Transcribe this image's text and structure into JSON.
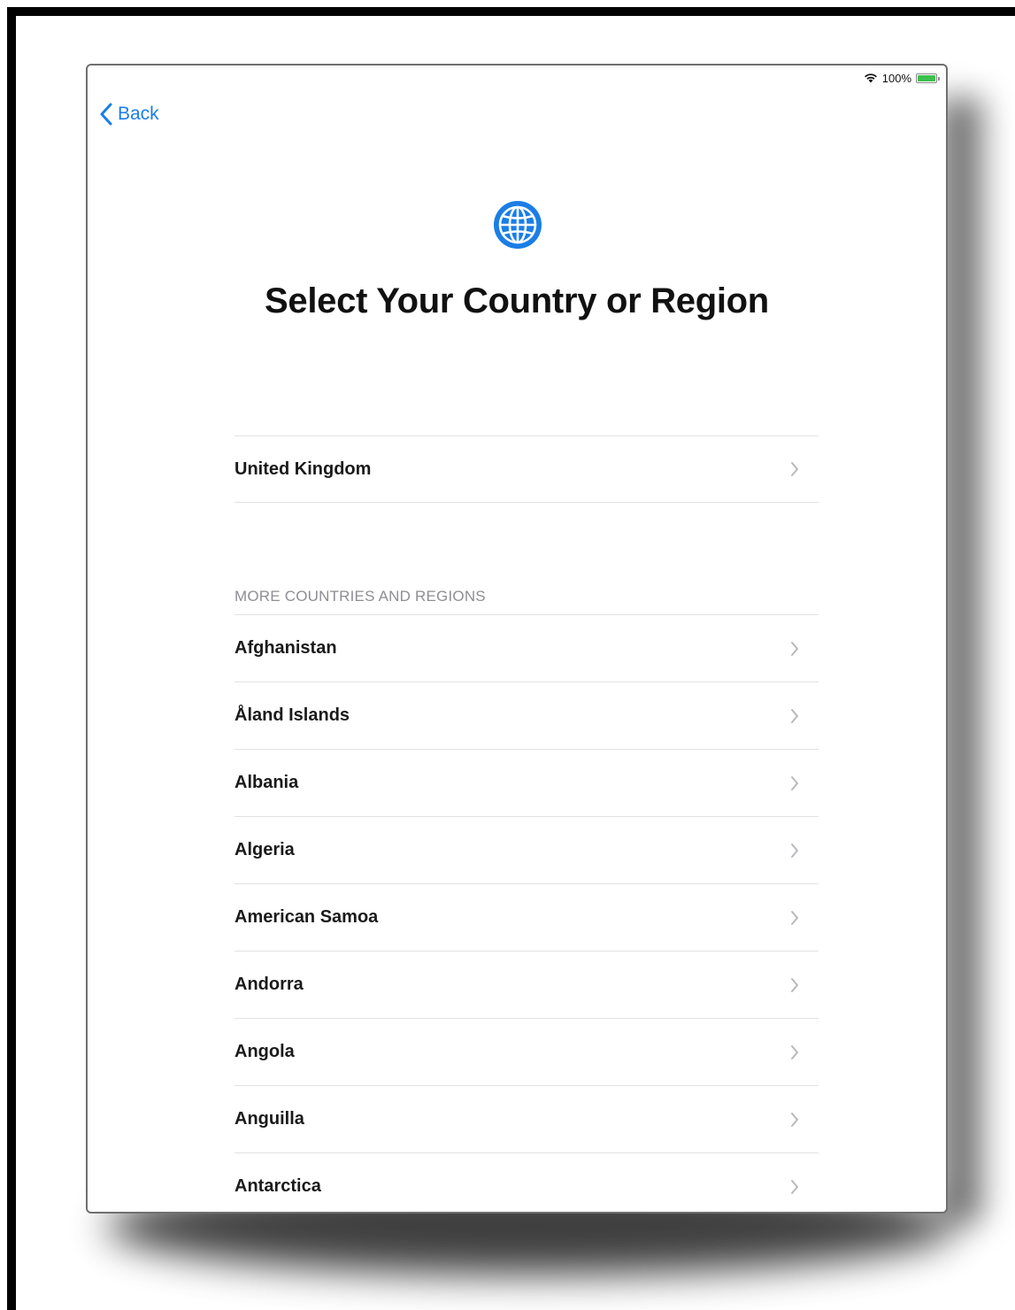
{
  "status_bar": {
    "icons": [
      "wifi-icon",
      "battery-icon"
    ],
    "battery_text": "100%",
    "battery_level": 1.0
  },
  "nav": {
    "back_label": "Back"
  },
  "header": {
    "icon": "globe-icon",
    "title": "Select Your Country or Region"
  },
  "suggested": {
    "items": [
      {
        "label": "United Kingdom"
      }
    ]
  },
  "more": {
    "section_title": "MORE COUNTRIES AND REGIONS",
    "items": [
      {
        "label": "Afghanistan"
      },
      {
        "label": "Åland Islands"
      },
      {
        "label": "Albania"
      },
      {
        "label": "Algeria"
      },
      {
        "label": "American Samoa"
      },
      {
        "label": "Andorra"
      },
      {
        "label": "Angola"
      },
      {
        "label": "Anguilla"
      },
      {
        "label": "Antarctica"
      }
    ]
  },
  "colors": {
    "accent": "#1a7ee6",
    "battery": "#3cc04e",
    "section_header": "#8e8e93"
  }
}
